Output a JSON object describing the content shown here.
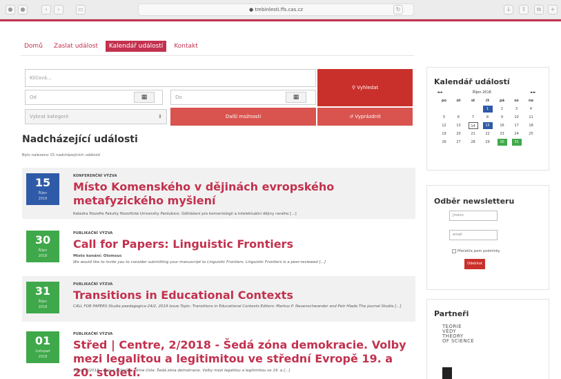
{
  "browser": {
    "url": "● trebinlesti.ffs.cas.cz"
  },
  "nav": {
    "items": [
      "Domů",
      "Zaslat událost",
      "Kalendář událostí",
      "Kontakt"
    ],
    "active": 2
  },
  "search": {
    "keyword_placeholder": "Klíčová...",
    "from_placeholder": "Od",
    "to_placeholder": "Do",
    "category_placeholder": "Vybrat kategorii",
    "search_button": "Vyhledat",
    "advanced_button": "Další možnosti",
    "reset_button": "Vyprázdnit"
  },
  "events_section": {
    "title": "Nadcházející události",
    "found_text": "Bylo nalezeno 15 nadcházejících událostí"
  },
  "events": [
    {
      "day": "15",
      "month": "Říjen",
      "year": "2018",
      "color": "#2e5aa8",
      "category": "KONFERENČNÍ VÝZVA",
      "title": "Místo Komenského v dějinách evropského metafyzického myšlení",
      "place": "",
      "desc": "Katedra filozofie Fakulty filozofické Univerzity Pardubice. Odhlášení pro komeniologii a intelektuální dějiny raného [...]"
    },
    {
      "day": "30",
      "month": "Říjen",
      "year": "2018",
      "color": "#3fa84a",
      "category": "PUBLIKAČNÍ VÝZVA",
      "title": "Call for Papers: Linguistic Frontiers",
      "place": "Místo konání: Olomouc",
      "desc": "We would like to invite you to consider submitting your manuscript to Linguistic Frontiers. Linguistic Frontiers is a peer-reviewed [...]"
    },
    {
      "day": "31",
      "month": "Říjen",
      "year": "2018",
      "color": "#3fa84a",
      "category": "PUBLIKAČNÍ VÝZVA",
      "title": "Transitions in Educational Contexts",
      "place": "",
      "desc": "CALL FOR PAPERS Studia paedagogica 24/2, 2019 Issue Topic: Transitions in Educational Contexts Editors: Markus P. Neuenschwander and Petr Hlado The journal Studia [...]"
    },
    {
      "day": "01",
      "month": "Listopad",
      "year": "2018",
      "color": "#3fa84a",
      "category": "PUBLIKAČNÍ VÝZVA",
      "title": "Střed | Centre, 2/2018 - Šedá zóna demokracie. Volby mezi legalitou a legitimitou ve střední Evropě 19. a 20. století.",
      "place": "",
      "desc": "Střed, 2/2018 – výzva autorům. Téma čísla: Šedá zóna demokracie. Volby mezi legalitou a legitimitou ve 19. a [...]"
    }
  ],
  "calendar": {
    "title": "Kalendář událostí",
    "prev": "◄◄",
    "next": "►►",
    "month_label": "Říjen 2018",
    "weekdays": [
      "po",
      "út",
      "st",
      "čt",
      "pá",
      "so",
      "ne"
    ],
    "weeks": [
      [
        "",
        "",
        "",
        "1",
        "2",
        "3",
        "4"
      ],
      [
        "5",
        "6",
        "7",
        "8",
        "9",
        "10",
        "11"
      ],
      [
        "12",
        "13",
        "14",
        "15",
        "16",
        "17",
        "18"
      ],
      [
        "19",
        "20",
        "21",
        "22",
        "23",
        "24",
        "25"
      ],
      [
        "26",
        "27",
        "28",
        "29",
        "30",
        "31",
        ""
      ]
    ],
    "selected_day": "1",
    "today": "14",
    "highlight_blue": "15",
    "highlight_green": [
      "30",
      "31"
    ]
  },
  "newsletter": {
    "title": "Odběr newsletteru",
    "name_placeholder": "Jméno",
    "email_placeholder": "email",
    "terms_label": "Přečetl/a jsem podmínky",
    "submit": "Odebírat"
  },
  "partners": {
    "title": "Partneři",
    "logo_lines": [
      "TEORIE",
      "VĚDY",
      "THEORY",
      "OF SCIENCE"
    ]
  },
  "colors": {
    "accent": "#c2314e",
    "blue": "#2e5aa8",
    "green": "#3fa84a",
    "red": "#d9534f"
  }
}
